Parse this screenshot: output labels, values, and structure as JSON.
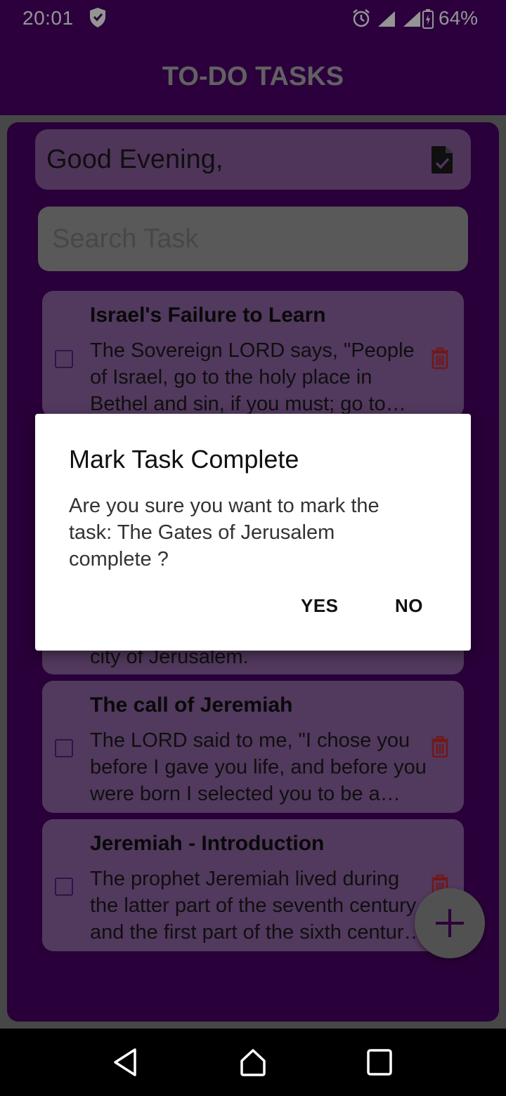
{
  "status_bar": {
    "time": "20:01",
    "battery": "64%",
    "icons": [
      "shield-icon",
      "alarm-icon",
      "signal-icon",
      "signal-icon",
      "battery-charging-icon"
    ]
  },
  "app_bar": {
    "title": "TO-DO TASKS"
  },
  "greeting": {
    "text": "Good Evening,",
    "icon": "task-document-check-icon"
  },
  "search": {
    "placeholder": "Search Task",
    "value": ""
  },
  "tasks": [
    {
      "title": "Israel's Failure to Learn",
      "description": "The Sovereign LORD says, \"People of Israel, go to the holy place in Bethel and sin, if you must; go to Gilgal and sin with all your might!",
      "completed": false
    },
    {
      "title": "",
      "description": "city of Jerusalem.",
      "completed": false
    },
    {
      "title": "The call of Jeremiah",
      "description": "The LORD said to me, \"I chose you before I gave you life, and before you were born I selected you to be a prophet to the nations.\"",
      "completed": false
    },
    {
      "title": "Jeremiah - Introduction",
      "description": "The prophet Jeremiah lived during the latter part of the seventh century and the first part of the sixth century B.C.",
      "completed": false
    }
  ],
  "fab": {
    "icon": "plus-icon"
  },
  "dialog": {
    "title": "Mark Task Complete",
    "message": "Are you sure you want to mark the task: The Gates of Jerusalem complete ?",
    "yes_label": "YES",
    "no_label": "NO"
  },
  "colors": {
    "primary": "#4a0068",
    "card": "#8e63a2",
    "delete": "#c62828",
    "title_text": "#a8a8a8"
  }
}
